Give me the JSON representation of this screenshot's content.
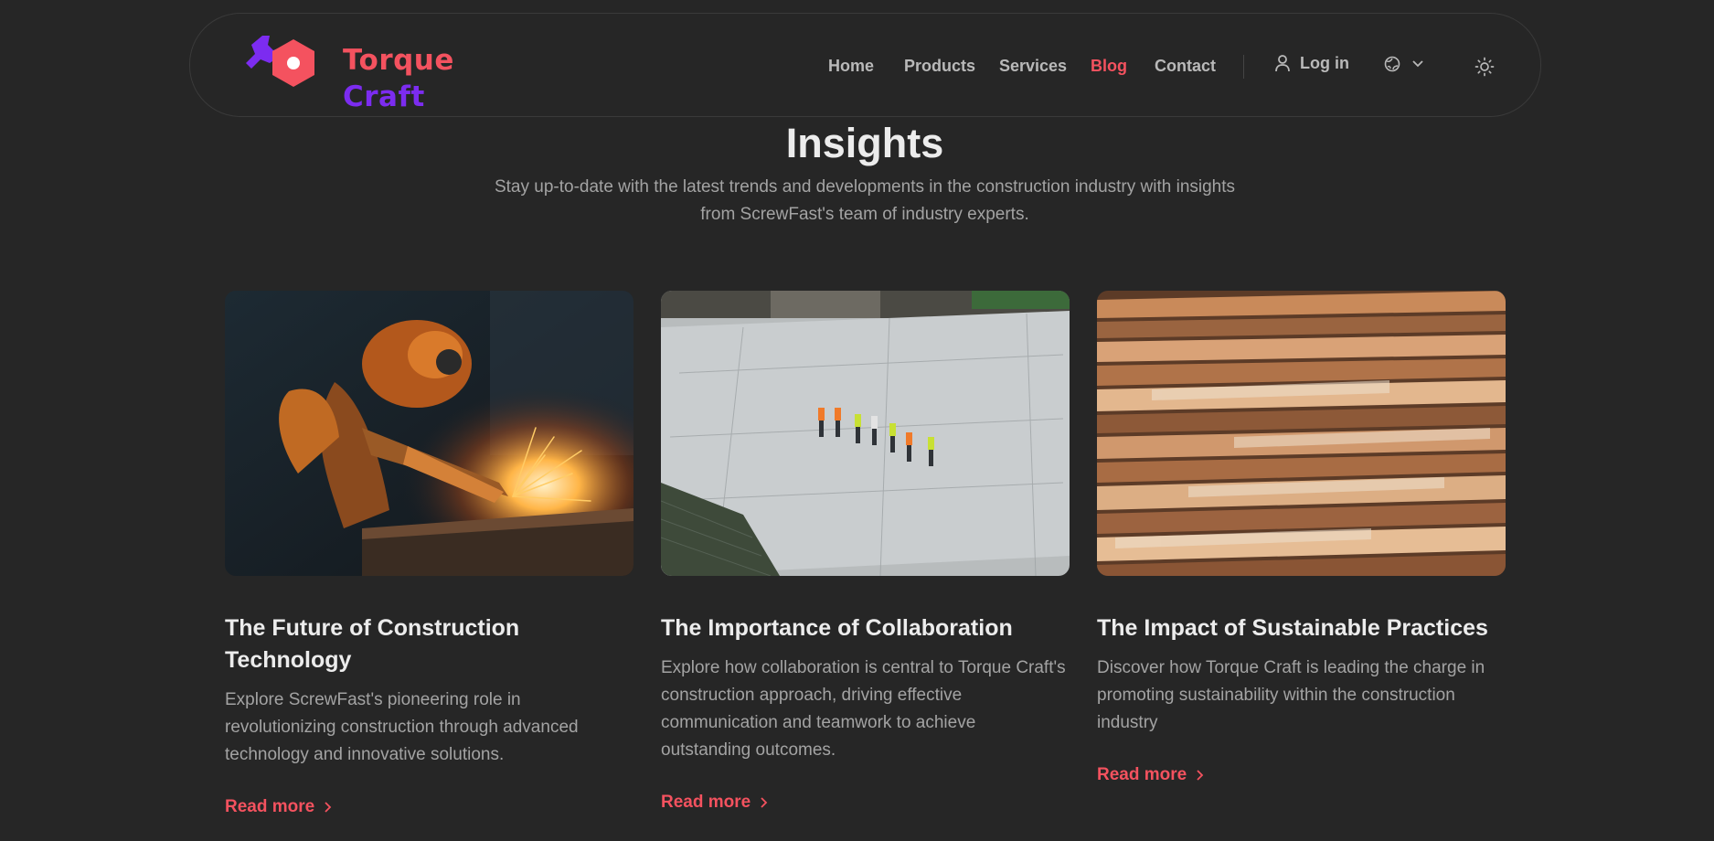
{
  "brand": {
    "word1": "Torque",
    "word2": "Craft",
    "colors": {
      "primary": "#f4525f",
      "secondary": "#7c2cf0"
    }
  },
  "nav": {
    "items": [
      {
        "label": "Home"
      },
      {
        "label": "Products"
      },
      {
        "label": "Services"
      },
      {
        "label": "Blog",
        "active": true
      },
      {
        "label": "Contact"
      }
    ],
    "login_label": "Log in",
    "icons": [
      "user-icon",
      "globe-icon",
      "chevron-down-icon",
      "sun-icon"
    ]
  },
  "section": {
    "title": "Insights",
    "subtitle": "Stay up-to-date with the latest trends and developments in the construction industry with insights from ScrewFast's team of industry experts."
  },
  "posts": [
    {
      "title": "The Future of Construction Technology",
      "description": "Explore ScrewFast's pioneering role in revolutionizing construction through advanced technology and innovative solutions.",
      "link_label": "Read more",
      "image": "robot-welding-photo"
    },
    {
      "title": "The Importance of Collaboration",
      "description": "Explore how collaboration is central to Torque Craft's construction approach, driving effective communication and teamwork to achieve outstanding outcomes.",
      "link_label": "Read more",
      "image": "construction-site-team-photo"
    },
    {
      "title": "The Impact of Sustainable Practices",
      "description": "Discover how Torque Craft is leading the charge in promoting sustainability within the construction industry",
      "link_label": "Read more",
      "image": "stacked-lumber-photo"
    }
  ]
}
